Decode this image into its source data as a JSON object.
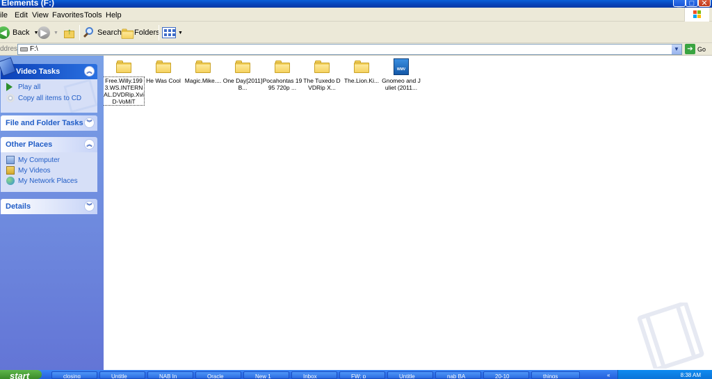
{
  "window": {
    "title": "Elements (F:)"
  },
  "menu": [
    "ile",
    "Edit",
    "View",
    "Favorites",
    "Tools",
    "Help"
  ],
  "toolbar": {
    "back": "Back",
    "search": "Search",
    "folders": "Folders"
  },
  "address": {
    "label": "ddress",
    "value": "F:\\",
    "go": "Go"
  },
  "sidebar": {
    "video_tasks": {
      "title": "Video Tasks",
      "items": [
        "Play all",
        "Copy all items to CD"
      ]
    },
    "file_folder_tasks": {
      "title": "File and Folder Tasks"
    },
    "other_places": {
      "title": "Other Places",
      "items": [
        "My Computer",
        "My Videos",
        "My Network Places"
      ]
    },
    "details": {
      "title": "Details"
    }
  },
  "files": [
    {
      "name": "Free.Willy.1993.WS.INTERNAL.DVDRip.XviD-VoMiT",
      "type": "folder",
      "selected": true
    },
    {
      "name": "He Was Cool",
      "type": "folder"
    },
    {
      "name": "Magic.Mike....",
      "type": "folder"
    },
    {
      "name": "One Day[2011]B...",
      "type": "folder"
    },
    {
      "name": "Pocahontas 1995 720p ...",
      "type": "folder"
    },
    {
      "name": "The Tuxedo DVDRip X...",
      "type": "folder"
    },
    {
      "name": "The.Lion.Ki...",
      "type": "folder"
    },
    {
      "name": "Gnomeo and Juliet (2011...",
      "type": "video",
      "badge": "WMV"
    }
  ],
  "taskbar": {
    "start": "start",
    "buttons": [
      "closing",
      "Untitle",
      "NAB In",
      "Oracle",
      "New 1",
      "Inbox",
      "FW: p",
      "Untitle",
      "nab BA",
      "20-10",
      "things"
    ],
    "clock": "8:38 AM"
  }
}
